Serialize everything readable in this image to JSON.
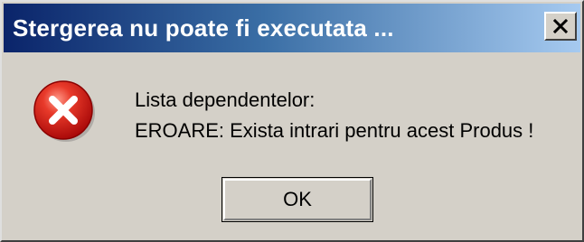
{
  "window": {
    "title": "Stergerea nu poate fi executata ...",
    "close_icon": "close-icon"
  },
  "message": {
    "icon": "error-icon",
    "line1": "Lista dependentelor:",
    "line2": "EROARE: Exista intrari pentru acest Produs !"
  },
  "buttons": {
    "ok_label": "OK"
  },
  "colors": {
    "titlebar_start": "#0a246a",
    "titlebar_end": "#a6caf0",
    "dialog_face": "#d4d0c8",
    "error_red": "#d81e1e"
  }
}
